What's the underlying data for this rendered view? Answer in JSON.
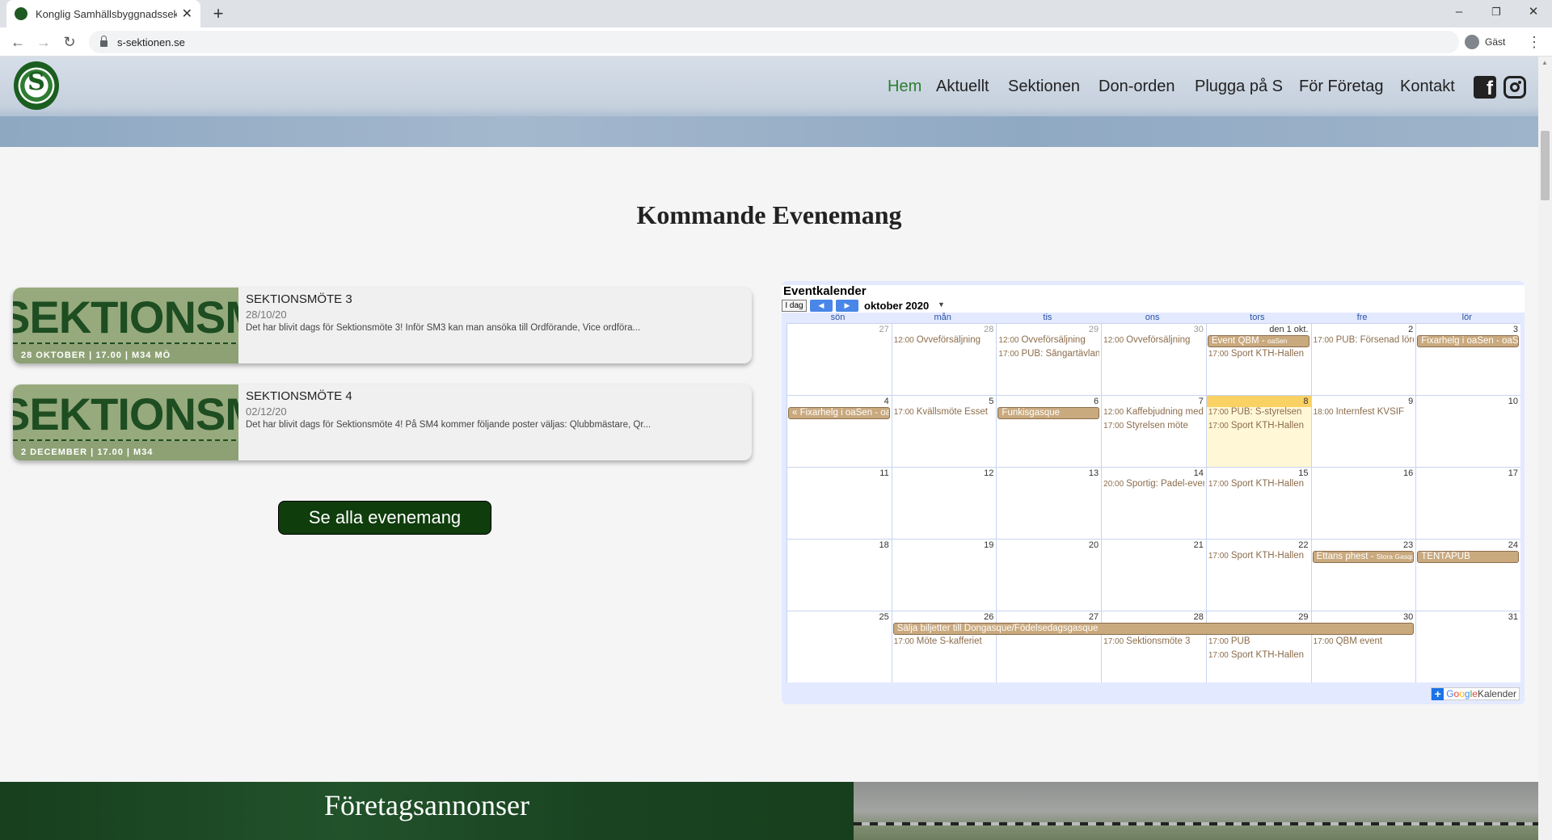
{
  "browser": {
    "tab_title": "Konglig Samhällsbyggnadssektio",
    "new_tab": "+",
    "url": "s-sektionen.se",
    "profile_label": "Gäst",
    "win_min": "–",
    "win_max": "❐",
    "win_close": "✕"
  },
  "nav": {
    "logo_letter": "S",
    "items": [
      "Hem",
      "Aktuellt",
      "Sektionen",
      "Don-orden",
      "Plugga på S",
      "För Företag",
      "Kontakt"
    ],
    "active": "Hem",
    "facebook_glyph": "f"
  },
  "events_section": {
    "title": "Kommande Evenemang",
    "cards": [
      {
        "title": "SEKTIONSMÖTE 3",
        "date": "28/10/20",
        "excerpt": "Det har blivit dags för Sektionsmöte 3! Inför SM3 kan man ansöka till Ordförande, Vice ordföra...",
        "thumb_text": "SEKTIONSMÖTE",
        "thumb_sub": "28 OKTOBER | 17.00 | M34 MÖ"
      },
      {
        "title": "SEKTIONSMÖTE 4",
        "date": "02/12/20",
        "excerpt": "Det har blivit dags för Sektionsmöte 4! På SM4 kommer följande poster väljas: Qlubbmästare, Qr...",
        "thumb_text": "SEKTIONSMÖTE",
        "thumb_sub": "2 DECEMBER | 17.00 | M34"
      }
    ],
    "see_all_label": "Se alla evenemang"
  },
  "calendar": {
    "title": "Eventkalender",
    "today_label": "I dag",
    "prev": "◀",
    "next": "▶",
    "month": "oktober 2020",
    "dropdown": "▼",
    "weekdays": [
      "sön",
      "mån",
      "tis",
      "ons",
      "tors",
      "fre",
      "lör"
    ],
    "weeks": [
      {
        "days": [
          "27",
          "28",
          "29",
          "30",
          "den 1 okt.",
          "2",
          "3"
        ],
        "off": [
          true,
          true,
          true,
          true,
          false,
          false,
          false
        ]
      },
      {
        "days": [
          "4",
          "5",
          "6",
          "7",
          "8",
          "9",
          "10"
        ],
        "off": [
          false,
          false,
          false,
          false,
          false,
          false,
          false
        ]
      },
      {
        "days": [
          "11",
          "12",
          "13",
          "14",
          "15",
          "16",
          "17"
        ],
        "off": [
          false,
          false,
          false,
          false,
          false,
          false,
          false
        ]
      },
      {
        "days": [
          "18",
          "19",
          "20",
          "21",
          "22",
          "23",
          "24"
        ],
        "off": [
          false,
          false,
          false,
          false,
          false,
          false,
          false
        ]
      },
      {
        "days": [
          "25",
          "26",
          "27",
          "28",
          "29",
          "30",
          "31"
        ],
        "off": [
          false,
          false,
          false,
          false,
          false,
          false,
          false
        ]
      }
    ],
    "timed_events": [
      {
        "week": 0,
        "day": 1,
        "slot": 0,
        "time": "12:00",
        "text": "Ovveförsäljning"
      },
      {
        "week": 0,
        "day": 2,
        "slot": 0,
        "time": "12:00",
        "text": "Ovveförsäljning"
      },
      {
        "week": 0,
        "day": 2,
        "slot": 1,
        "time": "17:00",
        "text": "PUB: Sångartävlan"
      },
      {
        "week": 0,
        "day": 3,
        "slot": 0,
        "time": "12:00",
        "text": "Ovveförsäljning"
      },
      {
        "week": 0,
        "day": 4,
        "slot": 1,
        "time": "17:00",
        "text": "Sport KTH-Hallen"
      },
      {
        "week": 0,
        "day": 5,
        "slot": 0,
        "time": "17:00",
        "text": "PUB: Försenad lördag"
      },
      {
        "week": 1,
        "day": 1,
        "slot": 0,
        "time": "17:00",
        "text": "Kvällsmöte Esset"
      },
      {
        "week": 1,
        "day": 3,
        "slot": 0,
        "time": "12:00",
        "text": "Kaffebjudning med"
      },
      {
        "week": 1,
        "day": 3,
        "slot": 1,
        "time": "17:00",
        "text": "Styrelsen möte"
      },
      {
        "week": 1,
        "day": 4,
        "slot": 0,
        "time": "17:00",
        "text": "PUB: S-styrelsen"
      },
      {
        "week": 1,
        "day": 4,
        "slot": 1,
        "time": "17:00",
        "text": "Sport KTH-Hallen"
      },
      {
        "week": 1,
        "day": 5,
        "slot": 0,
        "time": "18:00",
        "text": "Internfest KVSIF"
      },
      {
        "week": 2,
        "day": 3,
        "slot": 0,
        "time": "20:00",
        "text": "Sportig: Padel-event"
      },
      {
        "week": 2,
        "day": 4,
        "slot": 0,
        "time": "17:00",
        "text": "Sport KTH-Hallen"
      },
      {
        "week": 3,
        "day": 4,
        "slot": 0,
        "time": "17:00",
        "text": "Sport KTH-Hallen"
      },
      {
        "week": 4,
        "day": 1,
        "slot": 1,
        "time": "17:00",
        "text": "Möte S-kafferiet"
      },
      {
        "week": 4,
        "day": 3,
        "slot": 1,
        "time": "17:00",
        "text": "Sektionsmöte 3"
      },
      {
        "week": 4,
        "day": 4,
        "slot": 1,
        "time": "17:00",
        "text": "PUB"
      },
      {
        "week": 4,
        "day": 4,
        "slot": 2,
        "time": "17:00",
        "text": "Sport KTH-Hallen"
      },
      {
        "week": 4,
        "day": 5,
        "slot": 1,
        "time": "17:00",
        "text": "QBM event"
      }
    ],
    "allday_events": [
      {
        "week": 0,
        "day": 4,
        "span": 1,
        "text": "Event QBM - ",
        "small": "oaSen"
      },
      {
        "week": 0,
        "day": 6,
        "span": 1,
        "text": "Fixarhelg i oaSen - oaSen",
        "small": ""
      },
      {
        "week": 1,
        "day": 0,
        "span": 1,
        "text": "« Fixarhelg i oaSen - oaSen",
        "small": ""
      },
      {
        "week": 1,
        "day": 2,
        "span": 1,
        "text": "Funkisgasque",
        "small": ""
      },
      {
        "week": 3,
        "day": 5,
        "span": 1,
        "text": "Ettans phest - ",
        "small": "Stora Gasque"
      },
      {
        "week": 3,
        "day": 6,
        "span": 1,
        "text": "TENTAPUB",
        "small": ""
      },
      {
        "week": 4,
        "day": 1,
        "span": 5,
        "text": "Sälja biljetter till Dongasque/Födelsedagsgasque",
        "small": ""
      }
    ],
    "today_cell": {
      "week": 1,
      "day": 4
    },
    "gcal_plus": "+",
    "gcal_label": "Kalender",
    "gcal_logo": [
      "G",
      "o",
      "o",
      "g",
      "l",
      "e"
    ]
  },
  "ads": {
    "title": "Företagsannonser"
  }
}
